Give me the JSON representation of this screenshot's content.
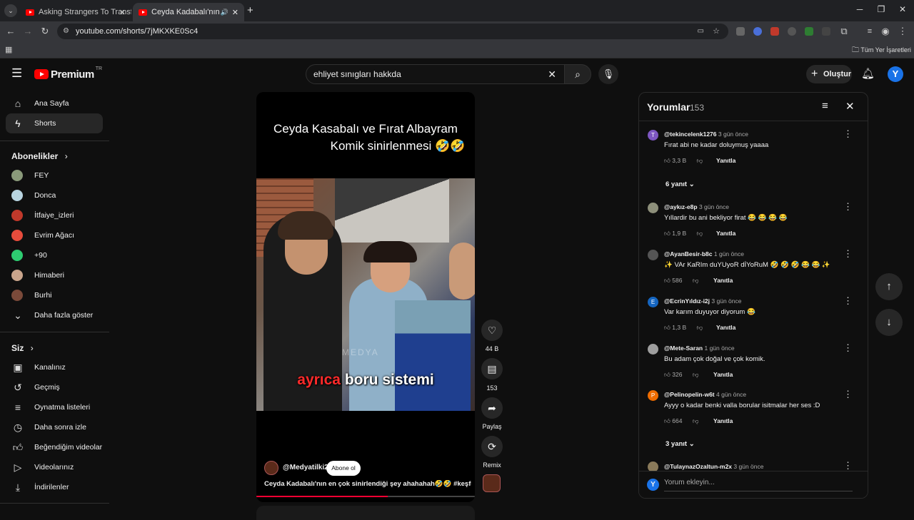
{
  "browser": {
    "tabs": [
      {
        "label": "Asking Strangers To Transform"
      },
      {
        "label": "Ceyda Kadabalı'nın en çok"
      }
    ],
    "url": "youtube.com/shorts/7jMKXKE0Sc4",
    "bookmarks_label": "Tüm Yer İşaretleri"
  },
  "header": {
    "logo": "Premium",
    "logo_sup": "TR",
    "search_value": "ehliyet sınıgları hakkda",
    "create_label": "Oluştur",
    "avatar_letter": "Y"
  },
  "sidebar": {
    "main": [
      {
        "label": "Ana Sayfa",
        "icon": "home-icon"
      },
      {
        "label": "Shorts",
        "icon": "shorts-icon"
      }
    ],
    "subs_title": "Abonelikler",
    "subs": [
      {
        "label": "FEY",
        "color": "#8a9a7a"
      },
      {
        "label": "Donca",
        "color": "#b8d4e0"
      },
      {
        "label": "İtfaiye_izleri",
        "color": "#c0392b"
      },
      {
        "label": "Evrim Ağacı",
        "color": "#e74c3c"
      },
      {
        "label": "+90",
        "color": "#2ecc71"
      },
      {
        "label": "Himaberi",
        "color": "#caa58c"
      },
      {
        "label": "Burhi",
        "color": "#7b4a3a"
      }
    ],
    "more_label": "Daha fazla göster",
    "you_title": "Siz",
    "you": [
      {
        "label": "Kanalınız",
        "icon": "channel-icon"
      },
      {
        "label": "Geçmiş",
        "icon": "history-icon"
      },
      {
        "label": "Oynatma listeleri",
        "icon": "playlist-icon"
      },
      {
        "label": "Daha sonra izle",
        "icon": "watch-later-icon"
      },
      {
        "label": "Beğendiğim videolar",
        "icon": "liked-icon"
      },
      {
        "label": "Videolarınız",
        "icon": "videos-icon"
      },
      {
        "label": "İndirilenler",
        "icon": "download-icon"
      }
    ]
  },
  "short": {
    "caption_line1": "Ceyda Kasabalı ve Fırat Albayram",
    "caption_line2": "Komik sinirlenmesi 🤣🤣",
    "subtitle_word1": "ayrıca",
    "subtitle_word2": "boru sistemi",
    "watermark": "MEDYA",
    "channel": "@Medyatilki2",
    "subscribe_label": "Abone ol",
    "title": "Ceyda Kadabalı'nın en çok sinirlendiği şey ahahahah🤣🤣 #keşfet ...",
    "actions": {
      "likes": "44 B",
      "comments": "153",
      "share": "Paylaş",
      "remix": "Remix"
    }
  },
  "comments": {
    "title": "Yorumlar",
    "count": "153",
    "input_placeholder": "Yorum ekleyin...",
    "reply_label": "Yanıtla",
    "items": [
      {
        "user": "@tekincelenk1276",
        "when": "3 gün önce",
        "text": "Fırat abi ne kadar doluymuş yaaaa",
        "likes": "3,3 B",
        "avatar": "T",
        "color": "#7e57c2",
        "replies": "6 yanıt"
      },
      {
        "user": "@aykız-e8p",
        "when": "3 gün önce",
        "text": "Yıllardir bu ani bekliyor firat 😂 😂 😂 😂",
        "likes": "1,9 B",
        "avatar": "",
        "color": "#8d8f7a",
        "replies": ""
      },
      {
        "user": "@AyanBesir-b8c",
        "when": "1 gün önce",
        "text": "✨ VAr KaRIm duYUyoR dİYoRuM 🤣 🤣 🤣 😂 😂 ✨",
        "likes": "586",
        "avatar": "",
        "color": "#555555",
        "replies": ""
      },
      {
        "user": "@EcrinYıldız-i2j",
        "when": "3 gün önce",
        "text": "Var karım duyuyor diyorum 😂",
        "likes": "1,3 B",
        "avatar": "E",
        "color": "#1565c0",
        "replies": ""
      },
      {
        "user": "@Mete-Saran",
        "when": "1 gün önce",
        "text": "Bu adam çok doğal ve çok komik.",
        "likes": "326",
        "avatar": "",
        "color": "#9e9e9e",
        "replies": ""
      },
      {
        "user": "@Pelinopelin-w6t",
        "when": "4 gün önce",
        "text": "Ayyy o kadar benki valla borular isitmalar her ses :D",
        "likes": "664",
        "avatar": "P",
        "color": "#ef6c00",
        "replies": "3 yanıt"
      },
      {
        "user": "@TulaynazOzaltun-m2x",
        "when": "3 gün önce",
        "text": "",
        "likes": "",
        "avatar": "",
        "color": "#8a7a5a",
        "replies": ""
      }
    ]
  }
}
